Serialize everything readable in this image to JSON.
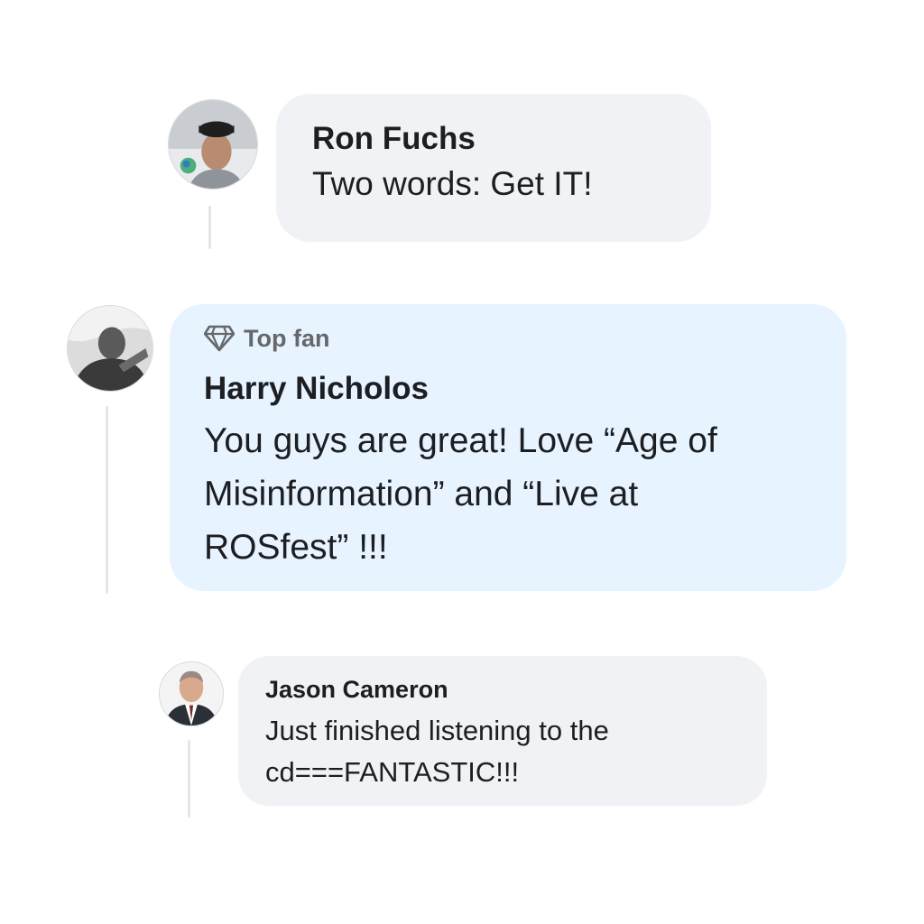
{
  "comments": [
    {
      "author": "Ron Fuchs",
      "text": "Two words: Get IT!",
      "bubble_color": "#f0f2f5"
    },
    {
      "badge": "Top fan",
      "badge_icon": "diamond-icon",
      "author": "Harry Nicholos",
      "text_lines": [
        "You guys are great! Love “Age of",
        "Misinformation” and “Live at",
        "ROSfest” !!!"
      ],
      "bubble_color": "#e7f3ff"
    },
    {
      "author": "Jason Cameron",
      "text_lines": [
        "Just finished listening to the",
        "cd===FANTASTIC!!!"
      ],
      "bubble_color": "#f0f2f5"
    }
  ],
  "colors": {
    "thread_line": "#e4e6eb",
    "badge_text": "#65676b",
    "text": "#1c1e21"
  }
}
